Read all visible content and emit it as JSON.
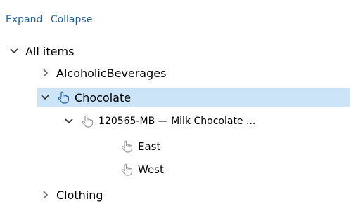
{
  "toolbar": {
    "expand_label": "Expand",
    "collapse_label": "Collapse"
  },
  "tree": {
    "root": {
      "label": "All items",
      "state": "expanded"
    },
    "alcoholic": {
      "label": "AlcoholicBeverages",
      "state": "collapsed"
    },
    "chocolate": {
      "label": "Chocolate",
      "state": "expanded",
      "selected": true,
      "icon": "hand-pointer-icon"
    },
    "product": {
      "label": "120565-MB — Milk Chocolate ...",
      "state": "expanded",
      "icon": "hand-pointer-icon"
    },
    "east": {
      "label": "East",
      "icon": "hand-pointer-icon"
    },
    "west": {
      "label": "West",
      "icon": "hand-pointer-icon"
    },
    "clothing": {
      "label": "Clothing",
      "state": "collapsed"
    }
  },
  "colors": {
    "link": "#1f5fa8",
    "selection": "#cce4f7",
    "icon_gray": "#9a9a9a",
    "icon_blue": "#1f5fa8"
  }
}
